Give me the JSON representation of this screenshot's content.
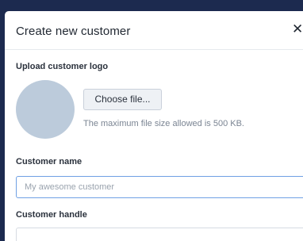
{
  "modal": {
    "title": "Create new customer",
    "close_icon": "close-icon",
    "close_glyph": "✕"
  },
  "logo_upload": {
    "label": "Upload customer logo",
    "button_label": "Choose file...",
    "help_text": "The maximum file size allowed is 500 KB."
  },
  "customer_name": {
    "label": "Customer name",
    "placeholder": "My awesome customer",
    "value": ""
  },
  "customer_handle": {
    "label": "Customer handle"
  },
  "colors": {
    "backdrop": "#1c2a4f",
    "avatar_placeholder": "#bccbdb",
    "focus_border": "#6fa0e4"
  }
}
